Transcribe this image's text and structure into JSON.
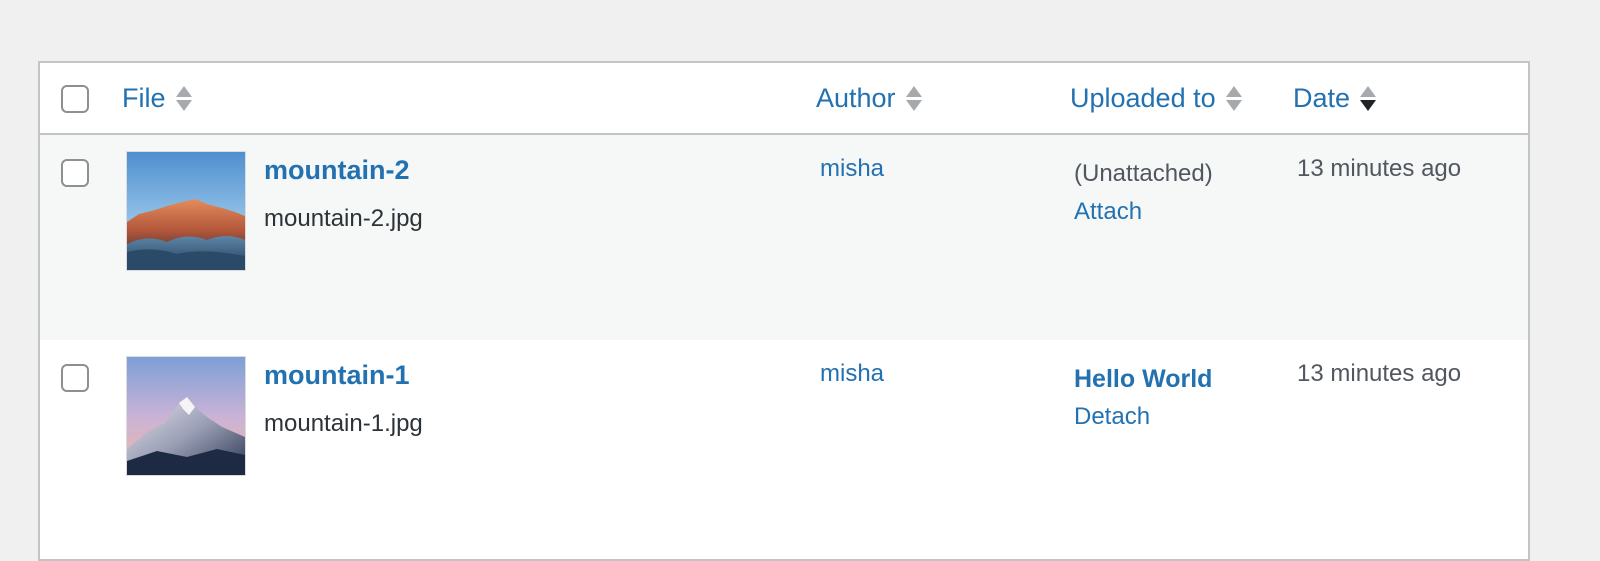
{
  "columns": {
    "file": "File",
    "author": "Author",
    "uploaded_to": "Uploaded to",
    "date": "Date"
  },
  "rows": [
    {
      "title": "mountain-2",
      "filename": "mountain-2.jpg",
      "author": "misha",
      "uploaded_status": "(Unattached)",
      "uploaded_action": "Attach",
      "date": "13 minutes ago",
      "thumb": "sunset-mountain-over-clouds"
    },
    {
      "title": "mountain-1",
      "filename": "mountain-1.jpg",
      "author": "misha",
      "uploaded_post": "Hello World",
      "uploaded_action": "Detach",
      "date": "13 minutes ago",
      "thumb": "snowy-peak-pink-sky"
    }
  ],
  "sort": {
    "column": "date",
    "direction": "desc"
  },
  "colors": {
    "link": "#2271b1",
    "page_bg": "#f0f0f1",
    "alt_row_bg": "#f6f7f7"
  }
}
